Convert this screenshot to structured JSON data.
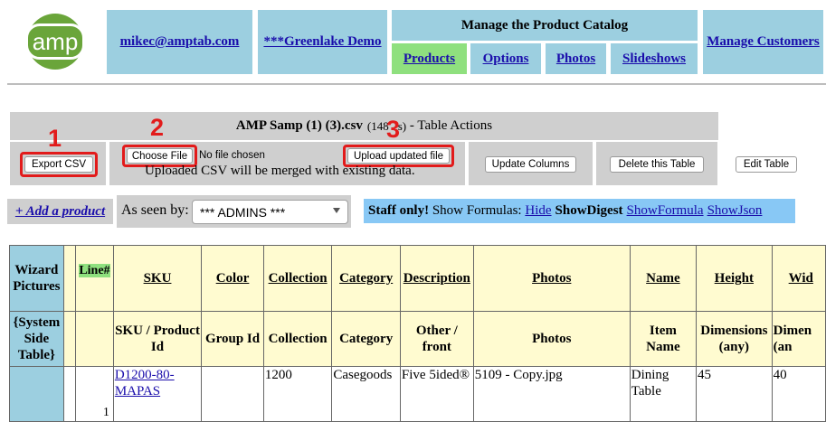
{
  "logo": {
    "text": "amp"
  },
  "nav": {
    "email": "mikec@amptab.com",
    "demo": "***Greenlake Demo",
    "catalog_title": "Manage the Product Catalog",
    "tabs": [
      "Products",
      "Options",
      "Photos",
      "Slideshows"
    ],
    "customers": "Manage Customers"
  },
  "table_actions": {
    "file_name": "AMP Samp (1) (3).csv",
    "rows_info": "(148 ",
    "rows_info_hidden": "s)",
    "suffix": " - Table Actions",
    "export_csv": "Export CSV",
    "choose_file": "Choose File",
    "no_file": "No file chosen",
    "upload_updated": "Upload updated file",
    "merge_note": "Uploaded CSV will be merged with existing data.",
    "update_columns": "Update Columns",
    "delete_table": "Delete this Table",
    "edit_table": "Edit Table"
  },
  "callouts": [
    "1",
    "2",
    "3"
  ],
  "toolbar": {
    "add_product": "+ Add a product",
    "as_seen_by": "As seen by:",
    "viewer_value": "*** ADMINS ***",
    "staff_only": "Staff only!",
    "show_formulas": " Show Formulas: ",
    "hide": "Hide",
    "show_digest": "ShowDigest",
    "show_formula": "ShowFormula",
    "show_json": "ShowJson"
  },
  "grid": {
    "side_header": "Wizard Pictures",
    "side_sub": "{System Side Table}",
    "headers": [
      "Line#",
      "SKU",
      "Color",
      "Collection",
      "Category",
      "Description",
      "Photos",
      "Name",
      "Height",
      "Wid"
    ],
    "subheaders": [
      "",
      "SKU / Product Id",
      "Group Id",
      "Collection",
      "Category",
      "Other / front",
      "Photos",
      "Item Name",
      "Dimensions (any)",
      "Dimen (an"
    ],
    "row": {
      "line": "1",
      "sku": "D1200-80-MAPAS",
      "color": "",
      "collection": "1200",
      "category": "Casegoods",
      "description": "Five 5ided®",
      "photos": "5109 - Copy.jpg",
      "name": "Dining Table",
      "height": "45",
      "width": "40"
    }
  }
}
